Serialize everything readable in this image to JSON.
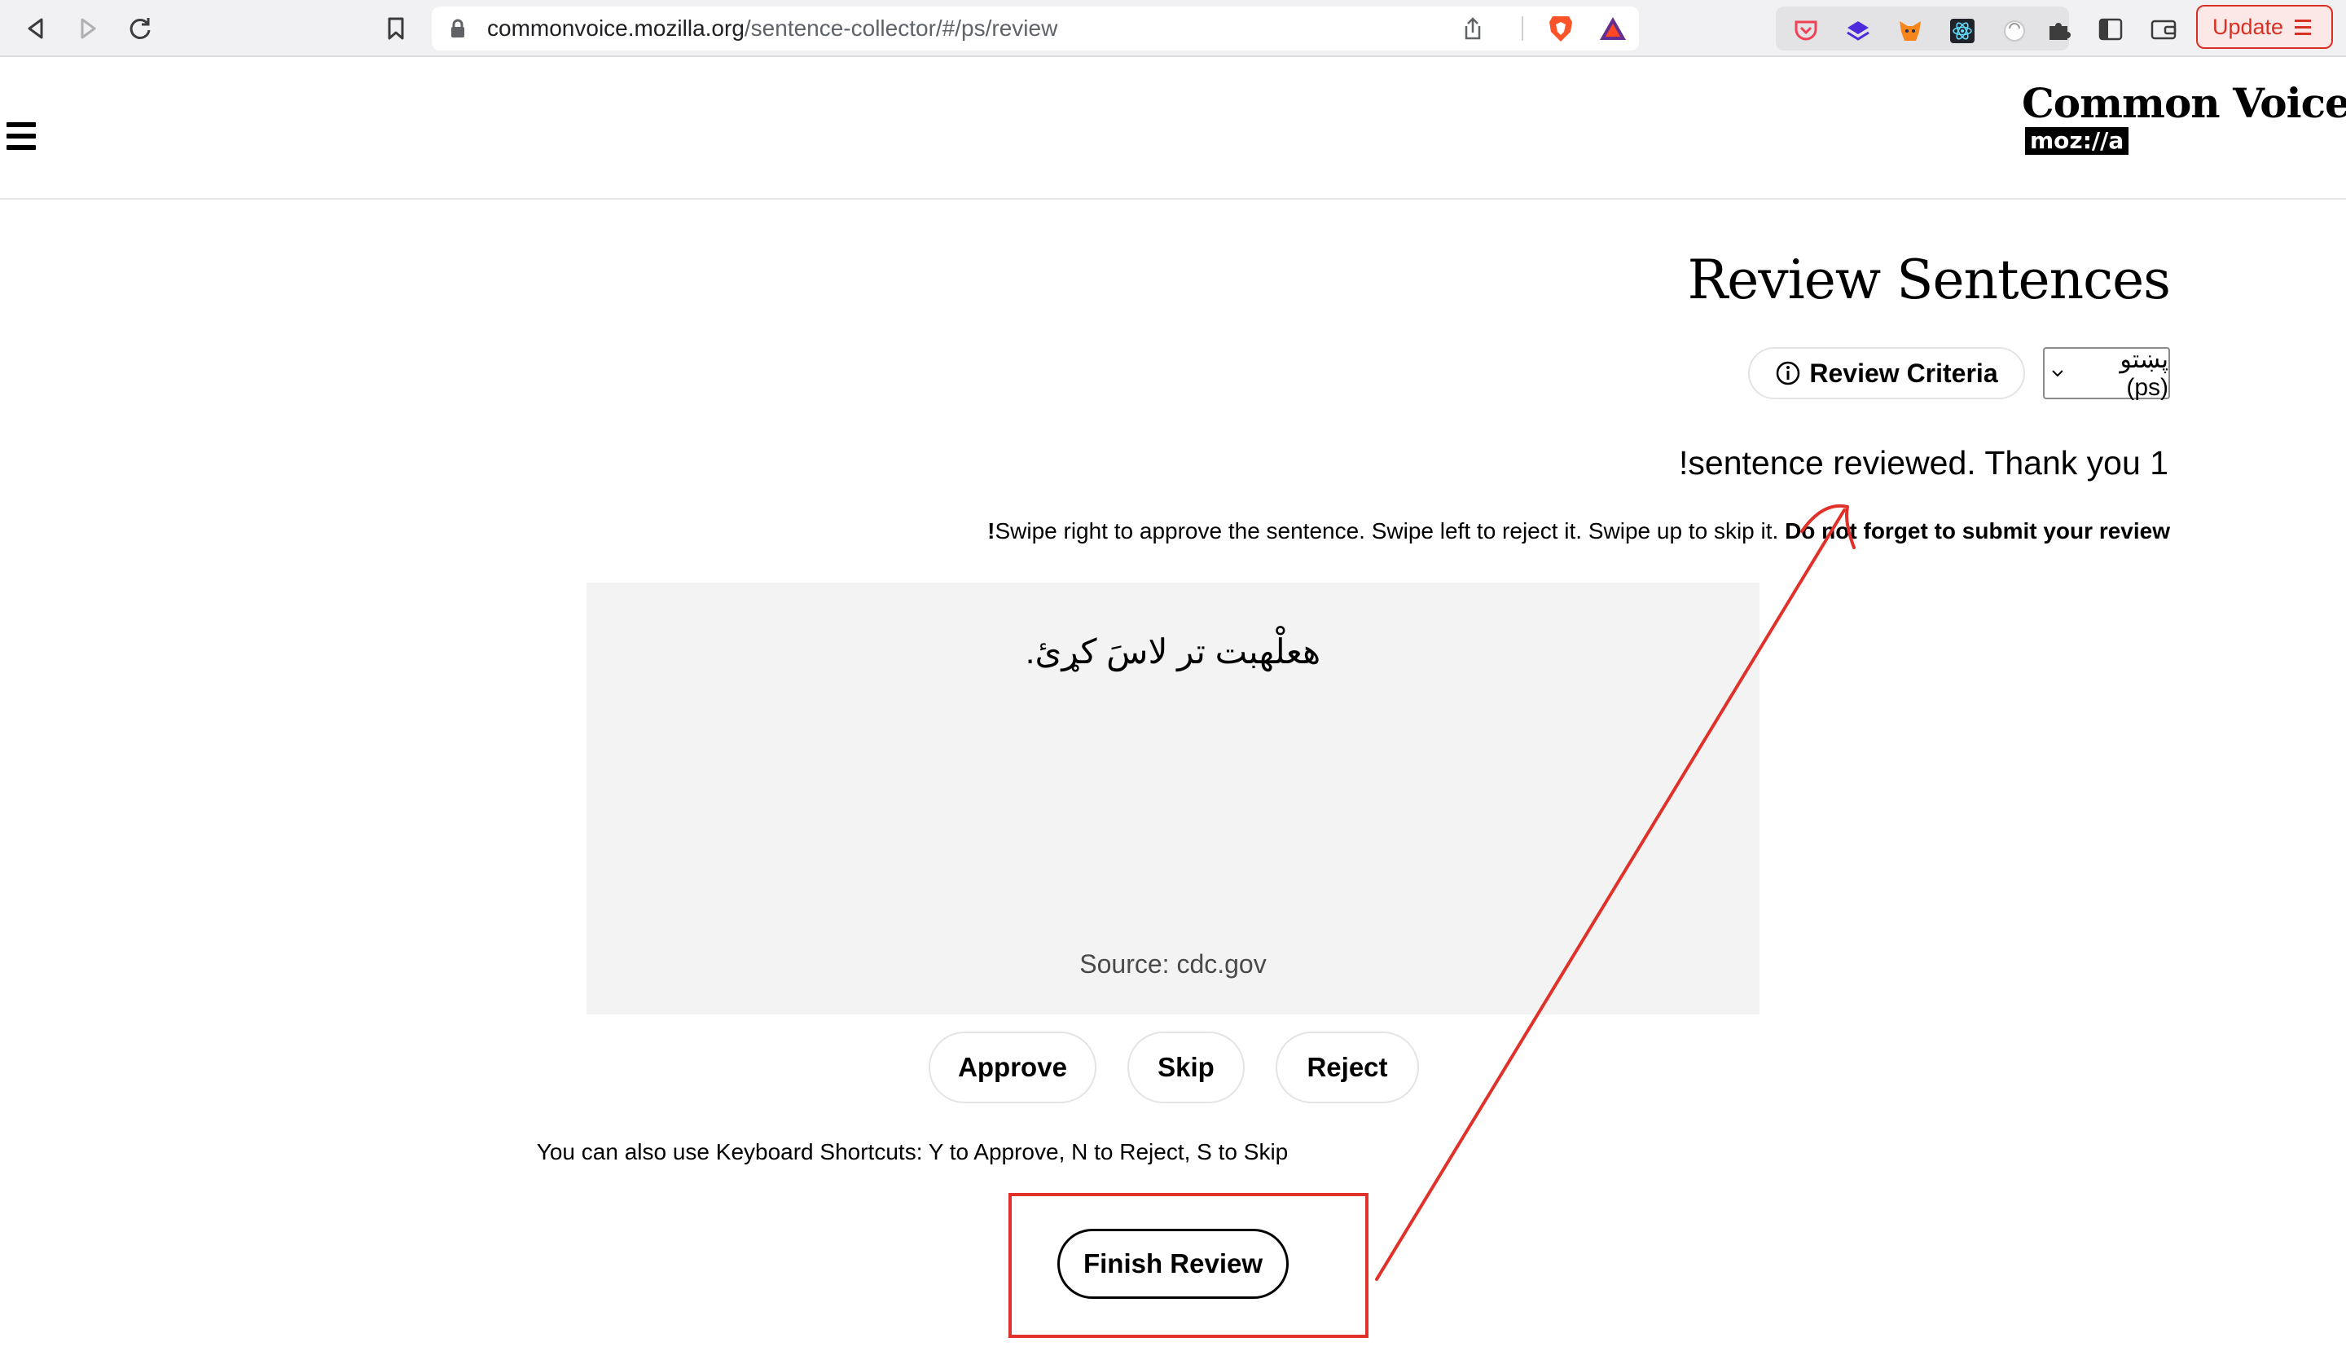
{
  "browser": {
    "url_host": "commonvoice.mozilla.org",
    "url_path": "/sentence-collector/#/ps/review",
    "update_label": "Update"
  },
  "header": {
    "logo_title": "Common Voice",
    "logo_subtitle": "moz://a"
  },
  "main": {
    "title": "Review Sentences",
    "criteria_button": "Review Criteria",
    "language_select": "پښتو (ps)",
    "thanks_message": "1 sentence reviewed. Thank you!",
    "swipe_hint": "Swipe right to approve the sentence. Swipe left to reject it. Swipe up to skip it.",
    "swipe_hint_bold": "Do not forget to submit your review!",
    "sentence": "هعلْهبت تر لاسَ کړئ.",
    "source": "Source: cdc.gov",
    "buttons": {
      "approve": "Approve",
      "skip": "Skip",
      "reject": "Reject"
    },
    "keyboard_hint": "You can also use Keyboard Shortcuts: Y to Approve, N to Reject, S to Skip",
    "finish_button": "Finish Review"
  },
  "colors": {
    "annotation": "#e0322a",
    "card_background": "#f3f3f3"
  }
}
